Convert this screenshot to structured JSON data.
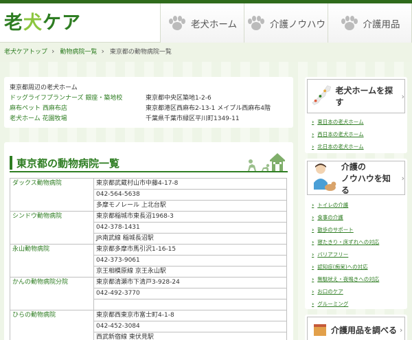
{
  "header": {
    "logo_left": "老",
    "logo_accent": "犬",
    "logo_right": "ケア",
    "nav": [
      {
        "label": "老犬ホーム",
        "icon": "paw-icon"
      },
      {
        "label": "介護ノウハウ",
        "icon": "paw-icon"
      },
      {
        "label": "介護用品",
        "icon": "paw-icon"
      }
    ]
  },
  "breadcrumb": [
    "老犬ケアトップ",
    "動物病院一覧",
    "東京都の動物病院一覧"
  ],
  "nearby": {
    "title": "東京都周辺の老犬ホーム",
    "items": [
      {
        "name": "ドッグライフプランナーズ 銀座・築地校",
        "address": "東京都中央区築地1-2-6"
      },
      {
        "name": "麻布ペット 西麻布店",
        "address": "東京都港区西麻布2-13-1 メイプル西麻布4階"
      },
      {
        "name": "老犬ホーム 花園牧場",
        "address": "千葉県千葉市緑区平川町1349-11"
      }
    ]
  },
  "section_title": "東京都の動物病院一覧",
  "hospitals": [
    {
      "name": "ダックス動物病院",
      "address": "東京都武蔵村山市中藤4-17-8",
      "phone": "042-564-5638",
      "station": "多摩モノレール 上北台駅"
    },
    {
      "name": "シンドウ動物病院",
      "address": "東京都稲城市東長沼1968-3",
      "phone": "042-378-1431",
      "station": "JR南武線 稲城長沼駅"
    },
    {
      "name": "永山動物病院",
      "address": "東京都多摩市馬引沢1-16-15",
      "phone": "042-373-9061",
      "station": "京王相模原線 京王永山駅"
    },
    {
      "name": "かんの動物病院分院",
      "address": "東京都清瀬市下清戸3-928-24",
      "phone": "042-492-3770",
      "station": ""
    },
    {
      "name": "ひらの動物病院",
      "address": "東京都西東京市富士町4-1-8",
      "phone": "042-452-3084",
      "station": "西武新宿線 東伏見駅"
    }
  ],
  "sidebar": {
    "home_title": "老犬ホームを探す",
    "home_links": [
      "東日本の老犬ホーム",
      "西日本の老犬ホーム",
      "北日本の老犬ホーム"
    ],
    "knowhow_title_1": "介護の",
    "knowhow_title_2": "ノウハウを知る",
    "knowhow_links": [
      "トイレの介護",
      "食事の介護",
      "散歩のサポート",
      "寝たきり・床ずれへの対応",
      "バリアフリー",
      "認知症(痴呆)への対応",
      "無駄吠え・夜鳴きへの対応",
      "お口のケア",
      "グルーミング"
    ],
    "goods_title": "介護用品を調べる"
  },
  "colors": {
    "brand": "#2e7d22",
    "accent": "#8cc63f",
    "topbar": "#2f6b1c"
  }
}
